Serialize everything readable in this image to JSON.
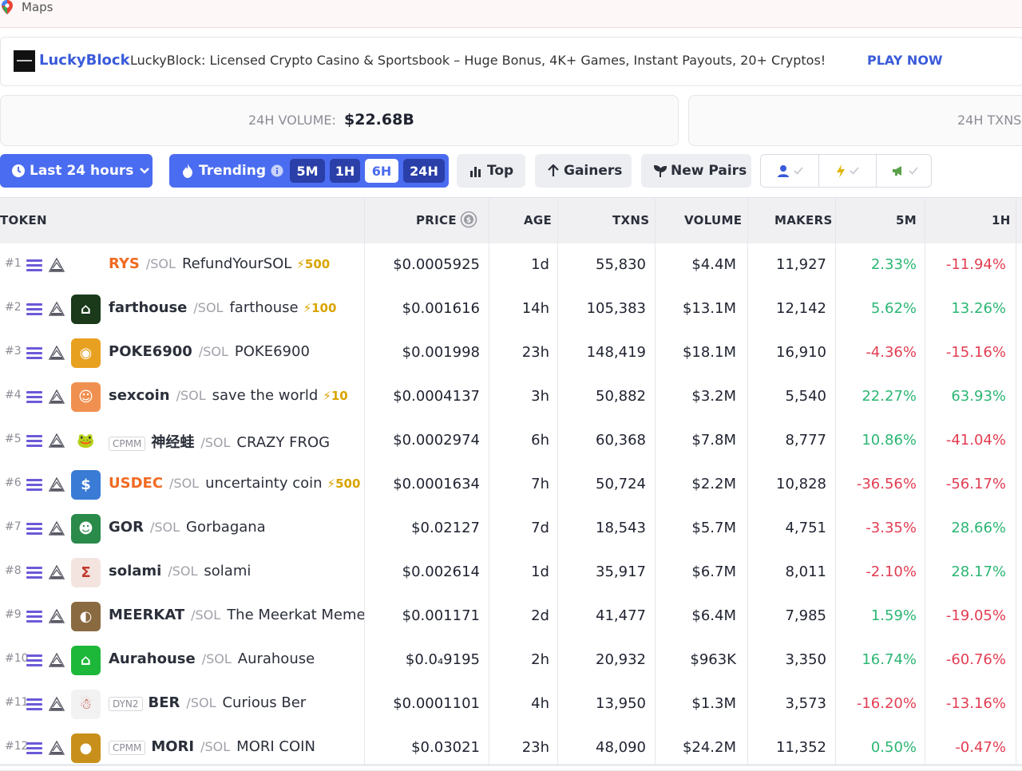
{
  "topbar": {
    "label": "Maps"
  },
  "ad": {
    "brand": "LuckyBlock",
    "text": "LuckyBlock: Licensed Crypto Casino & Sportsbook – Huge Bonus, 4K+ Games, Instant Payouts, 20+ Cryptos!",
    "cta": "PLAY NOW"
  },
  "stats": {
    "volume_label": "24H VOLUME:",
    "volume_value": "$22.68B",
    "txns_label": "24H TXNS:"
  },
  "filters": {
    "timeframe": "Last 24 hours",
    "trending": "Trending",
    "segments": [
      "5M",
      "1H",
      "6H",
      "24H"
    ],
    "active_segment": "6H",
    "top": "Top",
    "gainers": "Gainers",
    "new_pairs": "New Pairs"
  },
  "table": {
    "headers": {
      "token": "TOKEN",
      "price": "PRICE",
      "age": "AGE",
      "txns": "TXNS",
      "volume": "VOLUME",
      "makers": "MAKERS",
      "m5": "5M",
      "h1": "1H"
    },
    "rows": [
      {
        "rank": "#1",
        "tag": "",
        "symbol": "RYS",
        "quote": "/SOL",
        "name": "RefundYourSOL",
        "boost": "⚡500",
        "price": "$0.0005925",
        "age": "1d",
        "txns": "55,830",
        "volume": "$4.4M",
        "makers": "11,927",
        "m5": "2.33%",
        "h1": "-11.94%",
        "avatar_color": "#ffffff",
        "avatar_glyph": "",
        "symbol_color": "orange"
      },
      {
        "rank": "#2",
        "tag": "",
        "symbol": "farthouse",
        "quote": "/SOL",
        "name": "farthouse",
        "boost": "⚡100",
        "price": "$0.001616",
        "age": "14h",
        "txns": "105,383",
        "volume": "$13.1M",
        "makers": "12,142",
        "m5": "5.62%",
        "h1": "13.26%",
        "avatar_color": "#1a3a1a",
        "avatar_glyph": "⌂",
        "symbol_color": "dark"
      },
      {
        "rank": "#3",
        "tag": "",
        "symbol": "POKE6900",
        "quote": "/SOL",
        "name": "POKE6900",
        "boost": "",
        "price": "$0.001998",
        "age": "23h",
        "txns": "148,419",
        "volume": "$18.1M",
        "makers": "16,910",
        "m5": "-4.36%",
        "h1": "-15.16%",
        "avatar_color": "#e8a020",
        "avatar_glyph": "◉",
        "symbol_color": "dark"
      },
      {
        "rank": "#4",
        "tag": "",
        "symbol": "sexcoin",
        "quote": "/SOL",
        "name": "save the world",
        "boost": "⚡10",
        "price": "$0.0004137",
        "age": "3h",
        "txns": "50,882",
        "volume": "$3.2M",
        "makers": "5,540",
        "m5": "22.27%",
        "h1": "63.93%",
        "avatar_color": "#f09050",
        "avatar_glyph": "☺",
        "symbol_color": "dark"
      },
      {
        "rank": "#5",
        "tag": "CPMM",
        "symbol": "神经蛙",
        "quote": "/SOL",
        "name": "CRAZY FROG",
        "boost": "",
        "price": "$0.0002974",
        "age": "6h",
        "txns": "60,368",
        "volume": "$7.8M",
        "makers": "8,777",
        "m5": "10.86%",
        "h1": "-41.04%",
        "avatar_color": "#ffffff",
        "avatar_glyph": "🐸",
        "symbol_color": "dark"
      },
      {
        "rank": "#6",
        "tag": "",
        "symbol": "USDEC",
        "quote": "/SOL",
        "name": "uncertainty coin",
        "boost": "⚡500",
        "price": "$0.0001634",
        "age": "7h",
        "txns": "50,724",
        "volume": "$2.2M",
        "makers": "10,828",
        "m5": "-36.56%",
        "h1": "-56.17%",
        "avatar_color": "#3a7bd5",
        "avatar_glyph": "$",
        "symbol_color": "orange"
      },
      {
        "rank": "#7",
        "tag": "",
        "symbol": "GOR",
        "quote": "/SOL",
        "name": "Gorbagana",
        "boost": "",
        "price": "$0.02127",
        "age": "7d",
        "txns": "18,543",
        "volume": "$5.7M",
        "makers": "4,751",
        "m5": "-3.35%",
        "h1": "28.66%",
        "avatar_color": "#2a8a4a",
        "avatar_glyph": "☻",
        "symbol_color": "dark"
      },
      {
        "rank": "#8",
        "tag": "",
        "symbol": "solami",
        "quote": "/SOL",
        "name": "solami",
        "boost": "",
        "price": "$0.002614",
        "age": "1d",
        "txns": "35,917",
        "volume": "$6.7M",
        "makers": "8,011",
        "m5": "-2.10%",
        "h1": "28.17%",
        "avatar_color": "#f4e4e0",
        "avatar_glyph": "Σ",
        "symbol_color": "dark"
      },
      {
        "rank": "#9",
        "tag": "",
        "symbol": "MEERKAT",
        "quote": "/SOL",
        "name": "The Meerkat Meme",
        "boost": "",
        "price": "$0.001171",
        "age": "2d",
        "txns": "41,477",
        "volume": "$6.4M",
        "makers": "7,985",
        "m5": "1.59%",
        "h1": "-19.05%",
        "avatar_color": "#8a6a40",
        "avatar_glyph": "◐",
        "symbol_color": "dark"
      },
      {
        "rank": "#10",
        "tag": "",
        "symbol": "Aurahouse",
        "quote": "/SOL",
        "name": "Aurahouse",
        "boost": "",
        "price": "$0.0₄9195",
        "age": "2h",
        "txns": "20,932",
        "volume": "$963K",
        "makers": "3,350",
        "m5": "16.74%",
        "h1": "-60.76%",
        "avatar_color": "#1db83a",
        "avatar_glyph": "⌂",
        "symbol_color": "dark"
      },
      {
        "rank": "#11",
        "tag": "DYN2",
        "symbol": "BER",
        "quote": "/SOL",
        "name": "Curious Ber",
        "boost": "",
        "price": "$0.0001101",
        "age": "4h",
        "txns": "13,950",
        "volume": "$1.3M",
        "makers": "3,573",
        "m5": "-16.20%",
        "h1": "-13.16%",
        "avatar_color": "#f2f2f2",
        "avatar_glyph": "☃",
        "symbol_color": "dark"
      },
      {
        "rank": "#12",
        "tag": "CPMM",
        "symbol": "MORI",
        "quote": "/SOL",
        "name": "MORI COIN",
        "boost": "",
        "price": "$0.03021",
        "age": "23h",
        "txns": "48,090",
        "volume": "$24.2M",
        "makers": "11,352",
        "m5": "0.50%",
        "h1": "-0.47%",
        "avatar_color": "#c8901a",
        "avatar_glyph": "●",
        "symbol_color": "dark"
      }
    ]
  }
}
